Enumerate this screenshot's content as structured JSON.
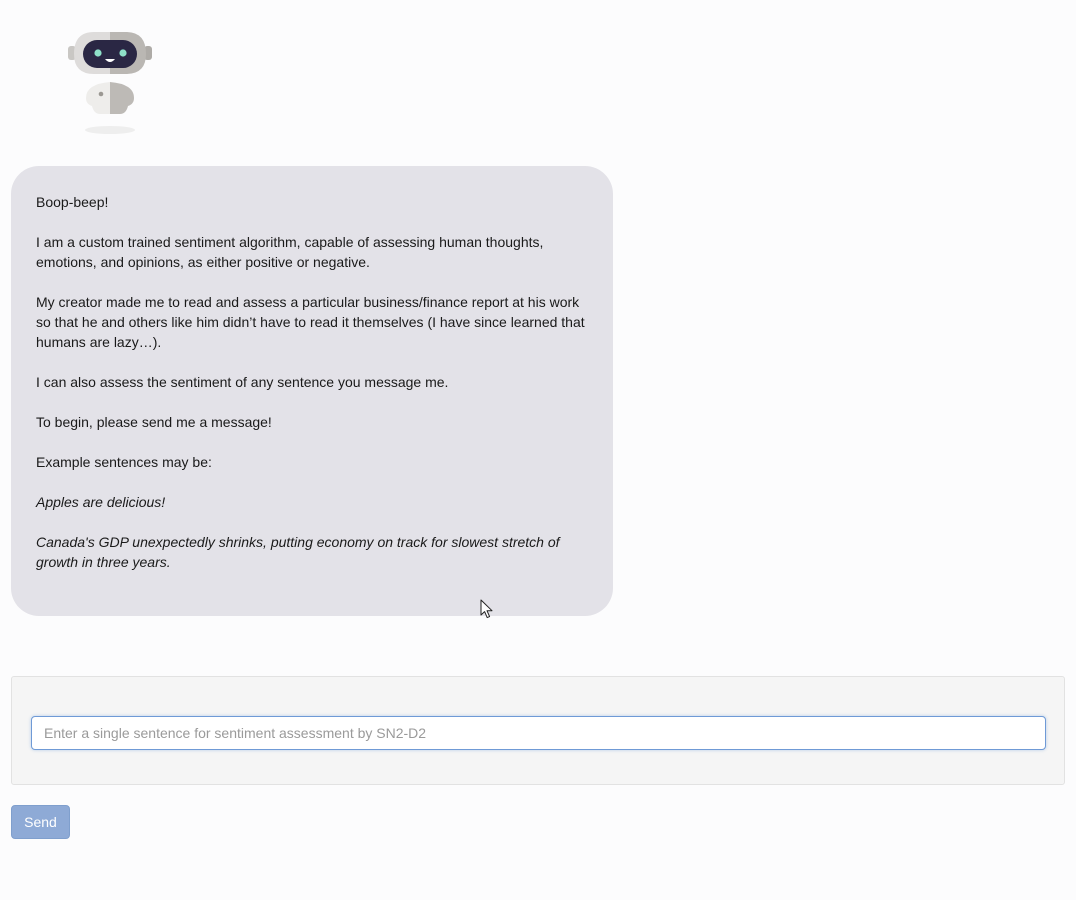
{
  "bot": {
    "avatar_icon": "robot-icon",
    "message": {
      "paragraphs": [
        "Boop-beep!",
        "I am a custom trained sentiment algorithm, capable of assessing human thoughts, emotions, and opinions, as either positive or negative.",
        "My creator made me to read and assess a particular business/finance report at his work so that he and others like him didn’t have to read it themselves (I have since learned that humans are lazy…).",
        "I can also assess the sentiment of any sentence you message me.",
        "To begin, please send me a message!",
        "Example sentences may be:"
      ],
      "examples": [
        "Apples are delicious!",
        "Canada's GDP unexpectedly shrinks, putting economy on track for slowest stretch of growth in three years."
      ]
    }
  },
  "composer": {
    "input_value": "",
    "input_placeholder": "Enter a single sentence for sentiment assessment by SN2-D2",
    "send_label": "Send"
  },
  "colors": {
    "bubble_bg": "#e3e2e8",
    "send_bg": "#8eaad6",
    "input_focus_border": "#6f9ad6"
  }
}
